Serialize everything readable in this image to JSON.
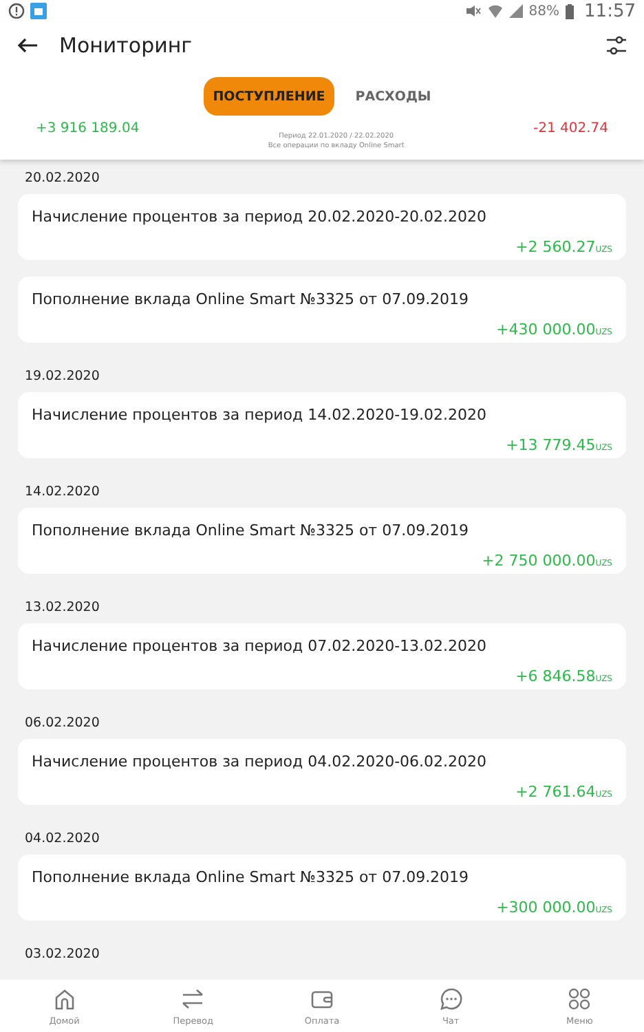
{
  "status_bar": {
    "battery": "88%",
    "time": "11:57"
  },
  "header": {
    "title": "Мониторинг"
  },
  "tabs": [
    {
      "label": "ПОСТУПЛЕНИЕ",
      "selected": true
    },
    {
      "label": "РАСХОДЫ",
      "selected": false
    }
  ],
  "summary": {
    "income": "+3 916 189.04",
    "expense": "-21 402.74",
    "period": "Период 22.01.2020 / 22.02.2020",
    "note": "Все операции по вкладу Online Smart"
  },
  "groups": [
    {
      "date": "20.02.2020",
      "items": [
        {
          "title": "Начисление процентов за период 20.02.2020-20.02.2020",
          "amount": "+2 560.27",
          "currency": "UZS"
        },
        {
          "title": "Пополнение вклада  Online Smart №3325 от 07.09.2019",
          "amount": "+430 000.00",
          "currency": "UZS"
        }
      ]
    },
    {
      "date": "19.02.2020",
      "items": [
        {
          "title": "Начисление процентов за период 14.02.2020-19.02.2020",
          "amount": "+13 779.45",
          "currency": "UZS"
        }
      ]
    },
    {
      "date": "14.02.2020",
      "items": [
        {
          "title": "Пополнение вклада  Online Smart №3325 от 07.09.2019",
          "amount": "+2 750 000.00",
          "currency": "UZS"
        }
      ]
    },
    {
      "date": "13.02.2020",
      "items": [
        {
          "title": "Начисление процентов за период 07.02.2020-13.02.2020",
          "amount": "+6 846.58",
          "currency": "UZS"
        }
      ]
    },
    {
      "date": "06.02.2020",
      "items": [
        {
          "title": "Начисление процентов за период 04.02.2020-06.02.2020",
          "amount": "+2 761.64",
          "currency": "UZS"
        }
      ]
    },
    {
      "date": "04.02.2020",
      "items": [
        {
          "title": "Пополнение вклада  Online Smart №3325 от 07.09.2019",
          "amount": "+300 000.00",
          "currency": "UZS"
        }
      ]
    },
    {
      "date": "03.02.2020"
    }
  ],
  "nav": [
    {
      "label": "Домой"
    },
    {
      "label": "Перевод"
    },
    {
      "label": "Оплата"
    },
    {
      "label": "Чат"
    },
    {
      "label": "Меню"
    }
  ]
}
